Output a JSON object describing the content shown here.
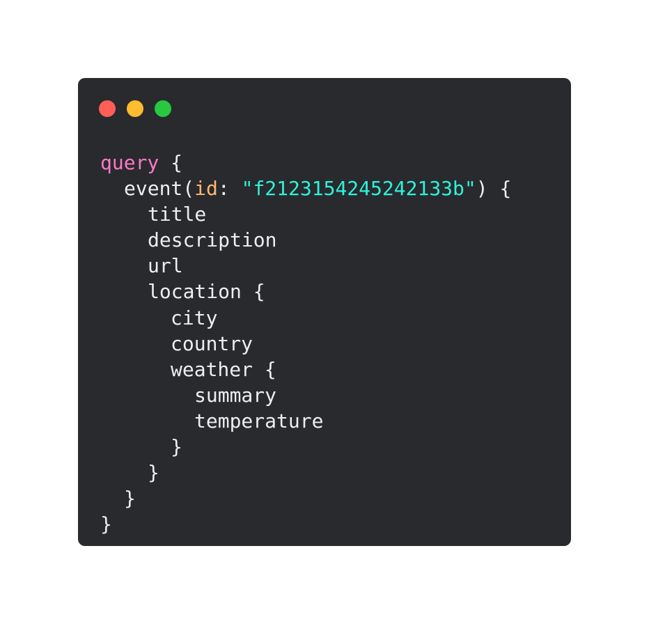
{
  "window": {
    "controls": [
      {
        "name": "close",
        "color": "#ff5f57"
      },
      {
        "name": "minimize",
        "color": "#febc2e"
      },
      {
        "name": "maximize",
        "color": "#28c840"
      }
    ]
  },
  "colors": {
    "background": "#282a2e",
    "text": "#eeeeee",
    "keyword": "#ff79c6",
    "argument": "#ffb86c",
    "string": "#2ef2d9"
  },
  "code": {
    "keyword": "query",
    "open_brace": "{",
    "close_brace": "}",
    "event_field": "event(",
    "arg_name": "id",
    "arg_colon": ": ",
    "arg_value": "\"f2123154245242133b\"",
    "event_close": ") {",
    "fields": {
      "title": "title",
      "description": "description",
      "url": "url",
      "location": "location {",
      "city": "city",
      "country": "country",
      "weather": "weather {",
      "summary": "summary",
      "temperature": "temperature"
    }
  }
}
